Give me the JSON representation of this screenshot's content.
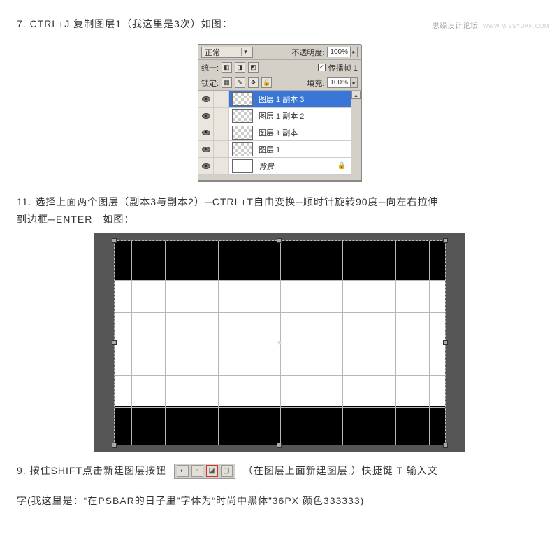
{
  "watermark": {
    "main": "思缘设计论坛",
    "sub": "WWW.MISSYUAN.COM"
  },
  "step7": "7. CTRL+J 复制图层1（我这里是3次）如图：",
  "layers_panel": {
    "blend_mode": "正常",
    "opacity_label": "不透明度:",
    "opacity_value": "100%",
    "unify_label": "统一:",
    "propagate_check": "✓",
    "propagate_label": "传播帧 1",
    "lock_label": "锁定:",
    "fill_label": "填充:",
    "fill_value": "100%",
    "layers": [
      {
        "name": "图层 1 副本 3",
        "selected": true
      },
      {
        "name": "图层 1 副本 2"
      },
      {
        "name": "图层 1 副本"
      },
      {
        "name": "图层 1"
      },
      {
        "name": "背景",
        "bg": true
      }
    ]
  },
  "step11a": "11. 选择上面两个图层（副本3与副本2）─CTRL+T自由变换─顺时针旋转90度─向左右拉伸",
  "step11b": "到边框─ENTER　如图：",
  "step9a": "9. 按住SHIFT点击新建图层按钮",
  "step9b": "（在图层上面新建图层.）快捷键 T 输入文",
  "step9c": "字(我这里是：“在PSBAR的日子里”字体为“时尚中黑体”36PX 颜色333333)",
  "toolbar_icons": {
    "i1": "◐",
    "i2": "▫",
    "i3": "◪",
    "i4": "▢"
  }
}
